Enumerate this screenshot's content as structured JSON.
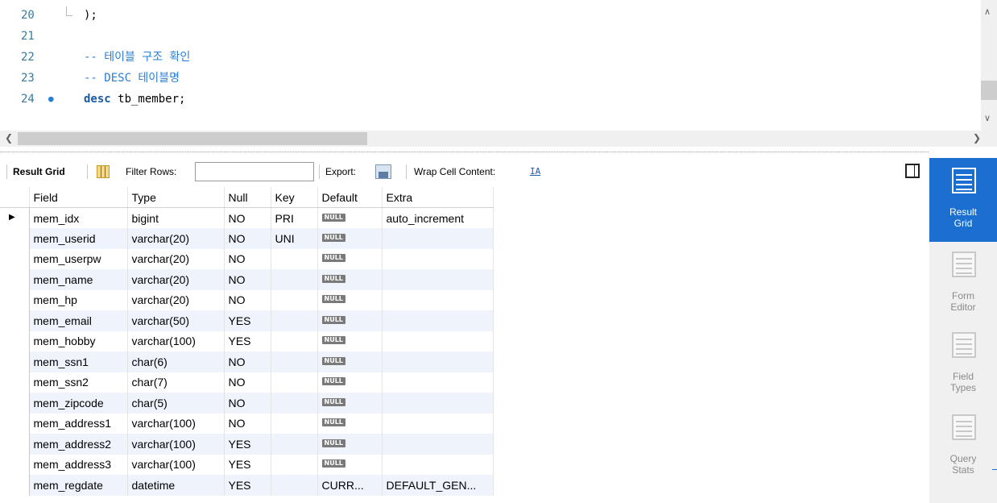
{
  "editor": {
    "lines": [
      {
        "num": "20",
        "code": ");"
      },
      {
        "num": "21",
        "code": ""
      },
      {
        "num": "22",
        "code": "-- 테이블 구조 확인"
      },
      {
        "num": "23",
        "code": "-- DESC 테이블명"
      },
      {
        "num": "24",
        "marker": "●",
        "keyword": "desc",
        "code": " tb_member;"
      }
    ]
  },
  "toolbar": {
    "result_grid_label": "Result Grid",
    "filter_rows_label": "Filter Rows:",
    "filter_rows_value": "",
    "export_label": "Export:",
    "wrap_cell_label": "Wrap Cell Content:",
    "wrap_icon_glyph": "IA"
  },
  "grid": {
    "columns": [
      "Field",
      "Type",
      "Null",
      "Key",
      "Default",
      "Extra"
    ],
    "null_badge": "NULL",
    "rows": [
      {
        "field": "mem_idx",
        "type": "bigint",
        "null": "NO",
        "key": "PRI",
        "default": null,
        "extra": "auto_increment"
      },
      {
        "field": "mem_userid",
        "type": "varchar(20)",
        "null": "NO",
        "key": "UNI",
        "default": null,
        "extra": ""
      },
      {
        "field": "mem_userpw",
        "type": "varchar(20)",
        "null": "NO",
        "key": "",
        "default": null,
        "extra": ""
      },
      {
        "field": "mem_name",
        "type": "varchar(20)",
        "null": "NO",
        "key": "",
        "default": null,
        "extra": ""
      },
      {
        "field": "mem_hp",
        "type": "varchar(20)",
        "null": "NO",
        "key": "",
        "default": null,
        "extra": ""
      },
      {
        "field": "mem_email",
        "type": "varchar(50)",
        "null": "YES",
        "key": "",
        "default": null,
        "extra": ""
      },
      {
        "field": "mem_hobby",
        "type": "varchar(100)",
        "null": "YES",
        "key": "",
        "default": null,
        "extra": ""
      },
      {
        "field": "mem_ssn1",
        "type": "char(6)",
        "null": "NO",
        "key": "",
        "default": null,
        "extra": ""
      },
      {
        "field": "mem_ssn2",
        "type": "char(7)",
        "null": "NO",
        "key": "",
        "default": null,
        "extra": ""
      },
      {
        "field": "mem_zipcode",
        "type": "char(5)",
        "null": "NO",
        "key": "",
        "default": null,
        "extra": ""
      },
      {
        "field": "mem_address1",
        "type": "varchar(100)",
        "null": "NO",
        "key": "",
        "default": null,
        "extra": ""
      },
      {
        "field": "mem_address2",
        "type": "varchar(100)",
        "null": "YES",
        "key": "",
        "default": null,
        "extra": ""
      },
      {
        "field": "mem_address3",
        "type": "varchar(100)",
        "null": "YES",
        "key": "",
        "default": null,
        "extra": ""
      },
      {
        "field": "mem_regdate",
        "type": "datetime",
        "null": "YES",
        "key": "",
        "default": "CURR...",
        "extra": "DEFAULT_GEN..."
      }
    ]
  },
  "sidepanel": {
    "buttons": [
      {
        "label_line1": "Result",
        "label_line2": "Grid",
        "active": true
      },
      {
        "label_line1": "Form",
        "label_line2": "Editor",
        "active": false
      },
      {
        "label_line1": "Field",
        "label_line2": "Types",
        "active": false
      },
      {
        "label_line1": "Query",
        "label_line2": "Stats",
        "active": false
      }
    ]
  },
  "colors": {
    "accent": "#1a6fd0",
    "comment": "#2a7fd4",
    "keyword": "#1a5aa6",
    "alt_row": "#eef3fc"
  }
}
